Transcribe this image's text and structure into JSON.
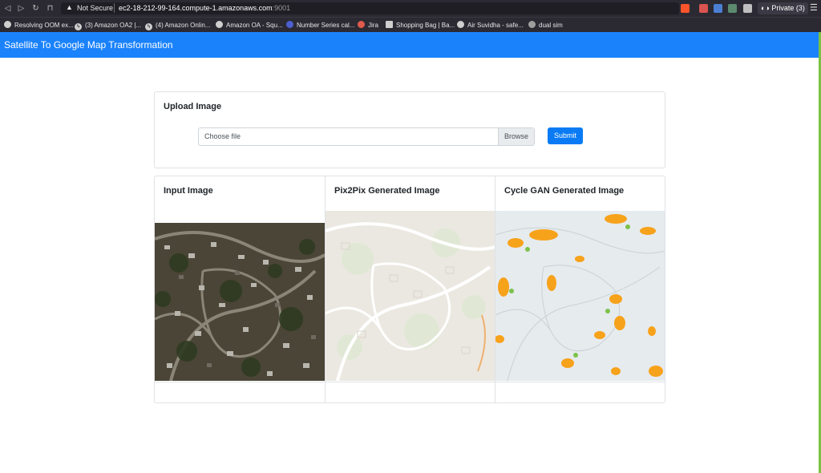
{
  "browser": {
    "security_label": "Not Secure",
    "url_host": "ec2-18-212-99-164.compute-1.amazonaws.com",
    "url_port": ":9001",
    "private_label": "Private (3)",
    "bookmarks": [
      "Resolving OOM ex...",
      "(3) Amazon OA2 |...",
      "(4) Amazon Onlin...",
      "Amazon OA - Squ...",
      "Number Series cal...",
      "Jira",
      "Shopping Bag | Ba...",
      "Air Suvidha - safe...",
      "dual sim"
    ]
  },
  "navbar": {
    "brand": "Satellite To Google Map Transformation"
  },
  "upload": {
    "title": "Upload Image",
    "file_placeholder": "Choose file",
    "browse_label": "Browse",
    "submit_label": "Submit"
  },
  "results": {
    "input_title": "Input Image",
    "pix2pix_title": "Pix2Pix Generated Image",
    "cyclegan_title": "Cycle GAN Generated Image"
  },
  "colors": {
    "navbar": "#1a82fb",
    "submit": "#0a7bf5"
  }
}
